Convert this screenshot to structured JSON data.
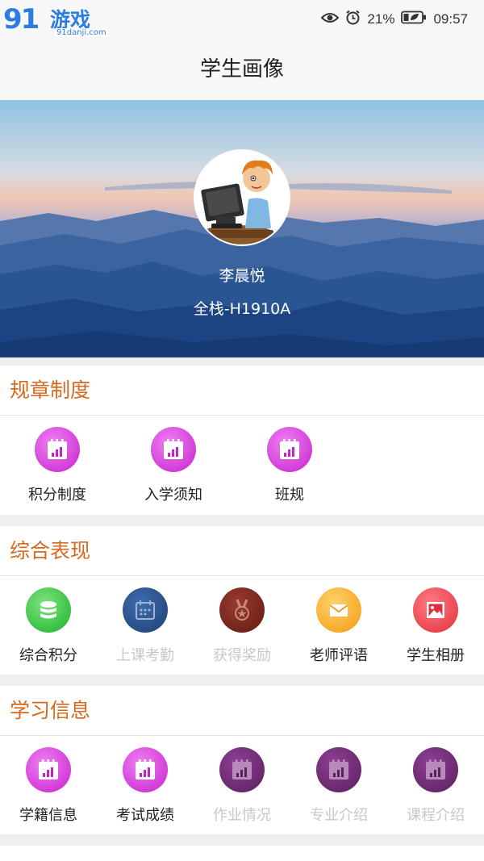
{
  "status": {
    "watermark_big": "91",
    "watermark_cn": "游戏",
    "watermark_url": "91danji.com",
    "battery": "21%",
    "time": "09:57"
  },
  "header": {
    "title": "学生画像"
  },
  "profile": {
    "name": "李晨悦",
    "class": "全栈-H1910A"
  },
  "sections": [
    {
      "title": "规章制度",
      "items": [
        {
          "label": "积分制度",
          "icon": "calendar-chart-icon",
          "dim": false
        },
        {
          "label": "入学须知",
          "icon": "calendar-chart-icon",
          "dim": false
        },
        {
          "label": "班规",
          "icon": "calendar-chart-icon",
          "dim": false
        }
      ]
    },
    {
      "title": "综合表现",
      "items": [
        {
          "label": "综合积分",
          "icon": "coin-stack-icon",
          "dim": false
        },
        {
          "label": "上课考勤",
          "icon": "attendance-calendar-icon",
          "dim": true
        },
        {
          "label": "获得奖励",
          "icon": "medal-icon",
          "dim": true
        },
        {
          "label": "老师评语",
          "icon": "envelope-icon",
          "dim": false
        },
        {
          "label": "学生相册",
          "icon": "photo-album-icon",
          "dim": false
        }
      ]
    },
    {
      "title": "学习信息",
      "items": [
        {
          "label": "学籍信息",
          "icon": "calendar-chart-icon",
          "dim": false
        },
        {
          "label": "考试成绩",
          "icon": "calendar-chart-icon",
          "dim": false
        },
        {
          "label": "作业情况",
          "icon": "calendar-chart-icon",
          "dim": true
        },
        {
          "label": "专业介绍",
          "icon": "calendar-chart-icon",
          "dim": true
        },
        {
          "label": "课程介绍",
          "icon": "calendar-chart-icon",
          "dim": true
        }
      ]
    }
  ],
  "colors": {
    "accent": "#d7691f",
    "magenta_icon": "#d632dc",
    "dim_purple_icon": "#6f2a74",
    "green_icon": "#2fc43a",
    "orange_icon": "#f6a81f",
    "red_icon": "#e8414b"
  }
}
